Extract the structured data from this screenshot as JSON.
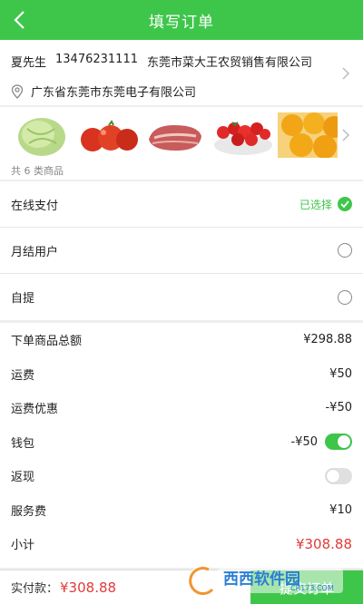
{
  "header": {
    "title": "填写订单"
  },
  "address": {
    "name": "夏先生",
    "phone": "13476231111",
    "company": "东莞市菜大王农贸销售有限公司",
    "location": "广东省东莞市东莞电子有限公司"
  },
  "goods": {
    "count_text": "共 6 类商品",
    "thumbnails": [
      "cabbage",
      "tomatoes",
      "meat",
      "strawberries",
      "oranges"
    ]
  },
  "payment": [
    {
      "label": "在线支付",
      "selected": true,
      "selected_text": "已选择"
    },
    {
      "label": "月结用户",
      "selected": false
    },
    {
      "label": "自提",
      "selected": false
    }
  ],
  "fees": [
    {
      "label": "下单商品总额",
      "value": "¥298.88"
    },
    {
      "label": "运费",
      "value": "¥50"
    },
    {
      "label": "运费优惠",
      "value": "-¥50"
    },
    {
      "label": "钱包",
      "value": "-¥50",
      "toggle": "on"
    },
    {
      "label": "返现",
      "value": "",
      "toggle": "off"
    },
    {
      "label": "服务费",
      "value": "¥10"
    },
    {
      "label": "小计",
      "value": "¥308.88",
      "highlight": true
    }
  ],
  "bottom": {
    "pay_label": "实付款：",
    "pay_value": "¥308.88",
    "submit_label": "提交订单"
  },
  "watermark": {
    "text": "西西软件园",
    "sub": "CR173.COM"
  },
  "colors": {
    "brand_green": "#3ec64b",
    "price_red": "#e03a3a"
  }
}
